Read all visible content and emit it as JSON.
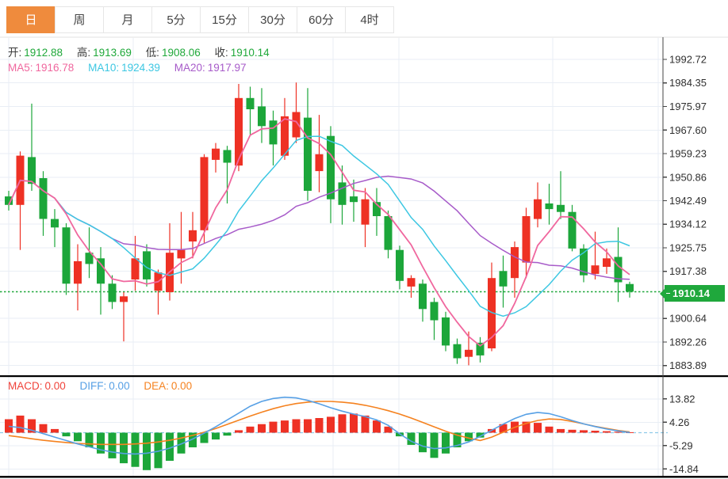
{
  "tabs": {
    "items": [
      {
        "label": "日",
        "active": true
      },
      {
        "label": "周",
        "active": false
      },
      {
        "label": "月",
        "active": false
      },
      {
        "label": "5分",
        "active": false
      },
      {
        "label": "15分",
        "active": false
      },
      {
        "label": "30分",
        "active": false
      },
      {
        "label": "60分",
        "active": false
      },
      {
        "label": "4时",
        "active": false
      }
    ]
  },
  "ohlc_legend": {
    "open_label": "开:",
    "open": "1912.88",
    "high_label": "高:",
    "high": "1913.69",
    "low_label": "低:",
    "low": "1908.06",
    "close_label": "收:",
    "close": "1910.14"
  },
  "ma_legend": {
    "ma5_label": "MA5:",
    "ma5": "1916.78",
    "ma10_label": "MA10:",
    "ma10": "1924.39",
    "ma20_label": "MA20:",
    "ma20": "1917.97"
  },
  "macd_legend": {
    "macd_label": "MACD:",
    "macd": "0.00",
    "diff_label": "DIFF:",
    "diff": "0.00",
    "dea_label": "DEA:",
    "dea": "0.00"
  },
  "price_axis": {
    "current_price": "1910.14",
    "ticks": [
      {
        "label": "1992.72",
        "value": 1992.72
      },
      {
        "label": "1984.35",
        "value": 1984.35
      },
      {
        "label": "1975.97",
        "value": 1975.97
      },
      {
        "label": "1967.60",
        "value": 1967.6
      },
      {
        "label": "1959.23",
        "value": 1959.23
      },
      {
        "label": "1950.86",
        "value": 1950.86
      },
      {
        "label": "1942.49",
        "value": 1942.49
      },
      {
        "label": "1934.12",
        "value": 1934.12
      },
      {
        "label": "1925.75",
        "value": 1925.75
      },
      {
        "label": "1917.38",
        "value": 1917.38
      },
      {
        "label": "1900.64",
        "value": 1900.64
      },
      {
        "label": "1892.26",
        "value": 1892.26
      },
      {
        "label": "1883.89",
        "value": 1883.89
      }
    ]
  },
  "macd_axis": {
    "ticks": [
      {
        "label": "13.82",
        "value": 13.82
      },
      {
        "label": "4.26",
        "value": 4.26
      },
      {
        "label": "-5.29",
        "value": -5.29
      },
      {
        "label": "-14.84",
        "value": -14.84
      }
    ]
  },
  "colors": {
    "up": "#ee3124",
    "down": "#1ca63a",
    "accent_tab": "#ef8b3d",
    "ma5": "#f0679e",
    "ma10": "#3dc7e2",
    "ma20": "#a75bc9",
    "diff": "#57a0e5",
    "dea": "#f5821f",
    "macd_text": "#f0433a",
    "grid": "#e9eef5",
    "axis_line": "#444444",
    "axis_text": "#2f2f2f",
    "current": "#1fa83c",
    "ohlc_value": "#1fa83a",
    "label_text": "#3c3c3c",
    "zero_dash": "#8ecbe9",
    "top_border": "#e2e2e2"
  },
  "chart_data": [
    {
      "type": "candlestick",
      "note": "Gold daily K-line; convention red=up green=down",
      "ylim": [
        1881,
        2000
      ],
      "current_price": 1910.14,
      "ma_periods": [
        5,
        10,
        20
      ],
      "ohlc": [
        [
          1944,
          1946,
          1939,
          1941
        ],
        [
          1941,
          1960,
          1925,
          1958.5
        ],
        [
          1958,
          1977,
          1946,
          1948.5
        ],
        [
          1950.5,
          1953,
          1930,
          1936
        ],
        [
          1936,
          1939.5,
          1926,
          1933
        ],
        [
          1933,
          1934.5,
          1909,
          1913
        ],
        [
          1913,
          1927,
          1903.5,
          1921
        ],
        [
          1924,
          1933,
          1915,
          1920
        ],
        [
          1922,
          1926,
          1902,
          1913
        ],
        [
          1913,
          1916,
          1904,
          1906.5
        ],
        [
          1906.5,
          1910,
          1892.5,
          1908.5
        ],
        [
          1914.5,
          1930,
          1910.5,
          1922
        ],
        [
          1924.5,
          1927,
          1912,
          1914.5
        ],
        [
          1910.5,
          1918,
          1902,
          1917
        ],
        [
          1910,
          1934.5,
          1907,
          1924
        ],
        [
          1922,
          1938.5,
          1913,
          1925
        ],
        [
          1928,
          1938.5,
          1922,
          1932
        ],
        [
          1932,
          1959,
          1927.5,
          1958
        ],
        [
          1957,
          1963,
          1952.5,
          1961
        ],
        [
          1960.5,
          1962,
          1941.5,
          1956
        ],
        [
          1955,
          1984,
          1953,
          1979
        ],
        [
          1979,
          1983,
          1966,
          1975
        ],
        [
          1976,
          1982.5,
          1963,
          1969
        ],
        [
          1971,
          1974.5,
          1955,
          1962.5
        ],
        [
          1958.5,
          1979,
          1957,
          1972.5
        ],
        [
          1965,
          1984.5,
          1963,
          1974
        ],
        [
          1972,
          1982.5,
          1942.5,
          1946
        ],
        [
          1953,
          1973,
          1945.5,
          1959
        ],
        [
          1965.5,
          1969,
          1934.5,
          1943
        ],
        [
          1949,
          1955,
          1934,
          1941
        ],
        [
          1944,
          1950,
          1935,
          1942
        ],
        [
          1934,
          1947,
          1926,
          1943
        ],
        [
          1942,
          1947,
          1930,
          1937
        ],
        [
          1937,
          1939,
          1922,
          1925
        ],
        [
          1925,
          1926.5,
          1911,
          1914
        ],
        [
          1912,
          1916,
          1908,
          1915
        ],
        [
          1913,
          1914.5,
          1899.5,
          1904
        ],
        [
          1906.5,
          1908,
          1893,
          1900
        ],
        [
          1901,
          1903,
          1889,
          1891
        ],
        [
          1891.5,
          1893.5,
          1884.5,
          1886.5
        ],
        [
          1887,
          1896,
          1884,
          1889.5
        ],
        [
          1892,
          1894,
          1885,
          1887.5
        ],
        [
          1890,
          1920.5,
          1889,
          1915
        ],
        [
          1917.5,
          1923,
          1904.5,
          1912
        ],
        [
          1915,
          1928,
          1908,
          1926
        ],
        [
          1920.5,
          1940,
          1915,
          1937
        ],
        [
          1936,
          1949,
          1933,
          1943
        ],
        [
          1941.5,
          1948.5,
          1934,
          1939.5
        ],
        [
          1941,
          1953,
          1936,
          1938.5
        ],
        [
          1938.5,
          1941,
          1924.5,
          1925.5
        ],
        [
          1925.5,
          1927,
          1913.5,
          1916
        ],
        [
          1916.5,
          1931.5,
          1914.5,
          1919.5
        ],
        [
          1919,
          1925.5,
          1916.5,
          1922
        ],
        [
          1922.5,
          1933,
          1906.5,
          1913.5
        ],
        [
          1912.88,
          1913.69,
          1908.06,
          1910.14
        ]
      ]
    },
    {
      "type": "bar+line",
      "name": "MACD",
      "ylim": [
        -22,
        22
      ],
      "histogram": [
        5.5,
        7,
        5.5,
        3.5,
        1.5,
        -1.5,
        -3.5,
        -6,
        -8.5,
        -10.5,
        -12.5,
        -14,
        -15.3,
        -14.5,
        -11.5,
        -8.5,
        -6,
        -4.2,
        -2.8,
        -1.2,
        1,
        2.5,
        3.5,
        4.5,
        5,
        5.5,
        5.5,
        6,
        6.5,
        7.5,
        7.8,
        7,
        5,
        2.5,
        -1.5,
        -5,
        -8,
        -10.3,
        -8.5,
        -6,
        -3.5,
        -2,
        1.5,
        3.5,
        4.5,
        4.5,
        4,
        2.5,
        1.5,
        1.2,
        1,
        0.8,
        0.6,
        0.4,
        0.2
      ],
      "diff_line": [
        2.6,
        2.1,
        1.0,
        -0.4,
        -1.8,
        -3.2,
        -4.6,
        -5.8,
        -7.0,
        -7.9,
        -8.5,
        -8.7,
        -8.4,
        -7.6,
        -6.3,
        -4.6,
        -2.6,
        -0.2,
        2.4,
        5.2,
        8.0,
        10.8,
        12.8,
        14.0,
        14.5,
        14.2,
        13.2,
        11.8,
        10.2,
        8.8,
        7.6,
        6.6,
        5.2,
        3.0,
        -0.5,
        -3.5,
        -5.5,
        -6.5,
        -6.2,
        -5.2,
        -3.8,
        -1.5,
        1.0,
        3.5,
        5.8,
        7.5,
        8.3,
        7.8,
        6.5,
        5.0,
        3.6,
        2.5,
        1.5,
        0.7,
        0.1
      ],
      "dea_line": [
        -1.2,
        -1.8,
        -2.5,
        -3.1,
        -3.6,
        -4.0,
        -4.4,
        -4.6,
        -4.8,
        -4.8,
        -4.8,
        -4.6,
        -4.3,
        -3.8,
        -3.1,
        -2.2,
        -1.1,
        0.2,
        1.7,
        3.4,
        5.1,
        6.8,
        8.4,
        9.8,
        11.0,
        11.9,
        12.5,
        12.8,
        12.8,
        12.5,
        12.0,
        11.2,
        10.2,
        9.0,
        7.6,
        6.0,
        4.2,
        2.4,
        0.6,
        -1.0,
        -2.2,
        -3.2,
        -1.8,
        0.2,
        2.2,
        3.8,
        5.0,
        5.6,
        5.4,
        4.6,
        3.6,
        2.6,
        1.7,
        0.9,
        0.3
      ]
    }
  ]
}
